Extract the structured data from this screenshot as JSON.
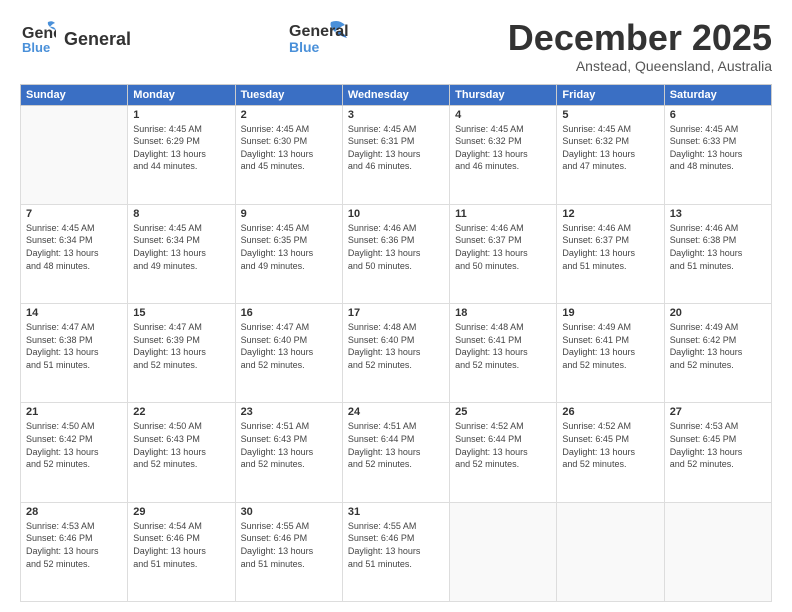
{
  "header": {
    "logo_general": "General",
    "logo_blue": "Blue",
    "month_title": "December 2025",
    "location": "Anstead, Queensland, Australia"
  },
  "days_of_week": [
    "Sunday",
    "Monday",
    "Tuesday",
    "Wednesday",
    "Thursday",
    "Friday",
    "Saturday"
  ],
  "weeks": [
    [
      {
        "day": "",
        "empty": true
      },
      {
        "day": "1",
        "sunrise": "Sunrise: 4:45 AM",
        "sunset": "Sunset: 6:29 PM",
        "daylight": "Daylight: 13 hours",
        "minutes": "and 44 minutes."
      },
      {
        "day": "2",
        "sunrise": "Sunrise: 4:45 AM",
        "sunset": "Sunset: 6:30 PM",
        "daylight": "Daylight: 13 hours",
        "minutes": "and 45 minutes."
      },
      {
        "day": "3",
        "sunrise": "Sunrise: 4:45 AM",
        "sunset": "Sunset: 6:31 PM",
        "daylight": "Daylight: 13 hours",
        "minutes": "and 46 minutes."
      },
      {
        "day": "4",
        "sunrise": "Sunrise: 4:45 AM",
        "sunset": "Sunset: 6:32 PM",
        "daylight": "Daylight: 13 hours",
        "minutes": "and 46 minutes."
      },
      {
        "day": "5",
        "sunrise": "Sunrise: 4:45 AM",
        "sunset": "Sunset: 6:32 PM",
        "daylight": "Daylight: 13 hours",
        "minutes": "and 47 minutes."
      },
      {
        "day": "6",
        "sunrise": "Sunrise: 4:45 AM",
        "sunset": "Sunset: 6:33 PM",
        "daylight": "Daylight: 13 hours",
        "minutes": "and 48 minutes."
      }
    ],
    [
      {
        "day": "7",
        "sunrise": "Sunrise: 4:45 AM",
        "sunset": "Sunset: 6:34 PM",
        "daylight": "Daylight: 13 hours",
        "minutes": "and 48 minutes."
      },
      {
        "day": "8",
        "sunrise": "Sunrise: 4:45 AM",
        "sunset": "Sunset: 6:34 PM",
        "daylight": "Daylight: 13 hours",
        "minutes": "and 49 minutes."
      },
      {
        "day": "9",
        "sunrise": "Sunrise: 4:45 AM",
        "sunset": "Sunset: 6:35 PM",
        "daylight": "Daylight: 13 hours",
        "minutes": "and 49 minutes."
      },
      {
        "day": "10",
        "sunrise": "Sunrise: 4:46 AM",
        "sunset": "Sunset: 6:36 PM",
        "daylight": "Daylight: 13 hours",
        "minutes": "and 50 minutes."
      },
      {
        "day": "11",
        "sunrise": "Sunrise: 4:46 AM",
        "sunset": "Sunset: 6:37 PM",
        "daylight": "Daylight: 13 hours",
        "minutes": "and 50 minutes."
      },
      {
        "day": "12",
        "sunrise": "Sunrise: 4:46 AM",
        "sunset": "Sunset: 6:37 PM",
        "daylight": "Daylight: 13 hours",
        "minutes": "and 51 minutes."
      },
      {
        "day": "13",
        "sunrise": "Sunrise: 4:46 AM",
        "sunset": "Sunset: 6:38 PM",
        "daylight": "Daylight: 13 hours",
        "minutes": "and 51 minutes."
      }
    ],
    [
      {
        "day": "14",
        "sunrise": "Sunrise: 4:47 AM",
        "sunset": "Sunset: 6:38 PM",
        "daylight": "Daylight: 13 hours",
        "minutes": "and 51 minutes."
      },
      {
        "day": "15",
        "sunrise": "Sunrise: 4:47 AM",
        "sunset": "Sunset: 6:39 PM",
        "daylight": "Daylight: 13 hours",
        "minutes": "and 52 minutes."
      },
      {
        "day": "16",
        "sunrise": "Sunrise: 4:47 AM",
        "sunset": "Sunset: 6:40 PM",
        "daylight": "Daylight: 13 hours",
        "minutes": "and 52 minutes."
      },
      {
        "day": "17",
        "sunrise": "Sunrise: 4:48 AM",
        "sunset": "Sunset: 6:40 PM",
        "daylight": "Daylight: 13 hours",
        "minutes": "and 52 minutes."
      },
      {
        "day": "18",
        "sunrise": "Sunrise: 4:48 AM",
        "sunset": "Sunset: 6:41 PM",
        "daylight": "Daylight: 13 hours",
        "minutes": "and 52 minutes."
      },
      {
        "day": "19",
        "sunrise": "Sunrise: 4:49 AM",
        "sunset": "Sunset: 6:41 PM",
        "daylight": "Daylight: 13 hours",
        "minutes": "and 52 minutes."
      },
      {
        "day": "20",
        "sunrise": "Sunrise: 4:49 AM",
        "sunset": "Sunset: 6:42 PM",
        "daylight": "Daylight: 13 hours",
        "minutes": "and 52 minutes."
      }
    ],
    [
      {
        "day": "21",
        "sunrise": "Sunrise: 4:50 AM",
        "sunset": "Sunset: 6:42 PM",
        "daylight": "Daylight: 13 hours",
        "minutes": "and 52 minutes."
      },
      {
        "day": "22",
        "sunrise": "Sunrise: 4:50 AM",
        "sunset": "Sunset: 6:43 PM",
        "daylight": "Daylight: 13 hours",
        "minutes": "and 52 minutes."
      },
      {
        "day": "23",
        "sunrise": "Sunrise: 4:51 AM",
        "sunset": "Sunset: 6:43 PM",
        "daylight": "Daylight: 13 hours",
        "minutes": "and 52 minutes."
      },
      {
        "day": "24",
        "sunrise": "Sunrise: 4:51 AM",
        "sunset": "Sunset: 6:44 PM",
        "daylight": "Daylight: 13 hours",
        "minutes": "and 52 minutes."
      },
      {
        "day": "25",
        "sunrise": "Sunrise: 4:52 AM",
        "sunset": "Sunset: 6:44 PM",
        "daylight": "Daylight: 13 hours",
        "minutes": "and 52 minutes."
      },
      {
        "day": "26",
        "sunrise": "Sunrise: 4:52 AM",
        "sunset": "Sunset: 6:45 PM",
        "daylight": "Daylight: 13 hours",
        "minutes": "and 52 minutes."
      },
      {
        "day": "27",
        "sunrise": "Sunrise: 4:53 AM",
        "sunset": "Sunset: 6:45 PM",
        "daylight": "Daylight: 13 hours",
        "minutes": "and 52 minutes."
      }
    ],
    [
      {
        "day": "28",
        "sunrise": "Sunrise: 4:53 AM",
        "sunset": "Sunset: 6:46 PM",
        "daylight": "Daylight: 13 hours",
        "minutes": "and 52 minutes."
      },
      {
        "day": "29",
        "sunrise": "Sunrise: 4:54 AM",
        "sunset": "Sunset: 6:46 PM",
        "daylight": "Daylight: 13 hours",
        "minutes": "and 51 minutes."
      },
      {
        "day": "30",
        "sunrise": "Sunrise: 4:55 AM",
        "sunset": "Sunset: 6:46 PM",
        "daylight": "Daylight: 13 hours",
        "minutes": "and 51 minutes."
      },
      {
        "day": "31",
        "sunrise": "Sunrise: 4:55 AM",
        "sunset": "Sunset: 6:46 PM",
        "daylight": "Daylight: 13 hours",
        "minutes": "and 51 minutes."
      },
      {
        "day": "",
        "empty": true
      },
      {
        "day": "",
        "empty": true
      },
      {
        "day": "",
        "empty": true
      }
    ]
  ]
}
